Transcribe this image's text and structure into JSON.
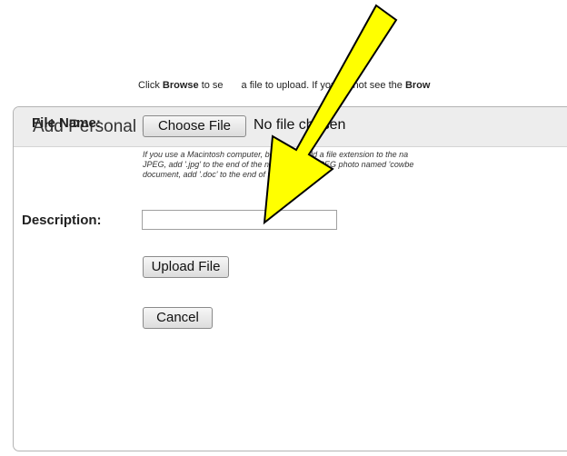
{
  "dialog": {
    "title": "Add Personal File"
  },
  "intro": {
    "pre": "Click ",
    "browse_bold": "Browse",
    "mid": " to se",
    "mid2": "a file to upload. If you do not see the ",
    "browse_bold2": "Brow"
  },
  "file_name": {
    "label": "File Name:",
    "button_label": "Choose File",
    "status": "No file chosen"
  },
  "note": {
    "line1": "If you use a Macintosh computer, be sure to add a file extension to the na",
    "line2": "JPEG, add '.jpg' to the end of the name (e.g., a JPEG photo named 'cowbe",
    "line3": "document, add '.doc' to the end of the name."
  },
  "description": {
    "label": "Description:",
    "value": "",
    "placeholder": ""
  },
  "actions": {
    "upload_label": "Upload File",
    "cancel_label": "Cancel"
  },
  "annotation": {
    "arrow_color": "#ffff00",
    "arrow_outline_color": "#000000",
    "icon": "pointer-arrow-icon"
  }
}
